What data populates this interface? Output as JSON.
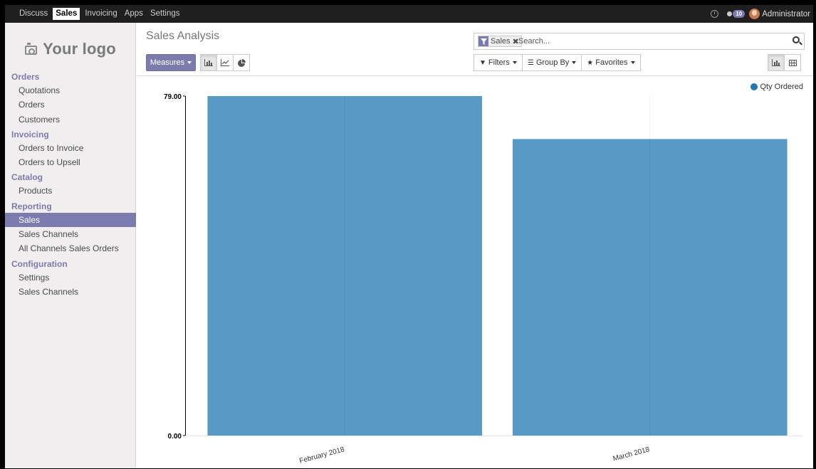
{
  "topbar": {
    "apps": [
      "Discuss",
      "Sales",
      "Invoicing",
      "Apps",
      "Settings"
    ],
    "active_app": "Sales",
    "messages_count": "10",
    "username": "Administrator"
  },
  "sidebar": {
    "logo_text": "Your logo",
    "sections": [
      {
        "title": "Orders",
        "items": [
          "Quotations",
          "Orders",
          "Customers"
        ]
      },
      {
        "title": "Invoicing",
        "items": [
          "Orders to Invoice",
          "Orders to Upsell"
        ]
      },
      {
        "title": "Catalog",
        "items": [
          "Products"
        ]
      },
      {
        "title": "Reporting",
        "items": [
          "Sales",
          "Sales Channels",
          "All Channels Sales Orders"
        ]
      },
      {
        "title": "Configuration",
        "items": [
          "Settings",
          "Sales Channels"
        ]
      }
    ],
    "active_item": "Reporting/Sales"
  },
  "control_panel": {
    "title": "Sales Analysis",
    "measures_label": "Measures",
    "search": {
      "facet_label": "Sales",
      "placeholder": "Search..."
    },
    "filters_label": "Filters",
    "groupby_label": "Group By",
    "favorites_label": "Favorites"
  },
  "colors": {
    "accent": "#7c7bad",
    "bar": "#5899c6",
    "legend_dot": "#1f77b4"
  },
  "chart_data": {
    "type": "bar",
    "categories": [
      "February 2018",
      "March 2018"
    ],
    "series": [
      {
        "name": "Qty Ordered",
        "values": [
          79,
          69
        ]
      }
    ],
    "ylim": [
      0,
      79
    ],
    "y_ticks": [
      "0.00",
      "79.00"
    ],
    "legend_position": "top-right",
    "grid": false
  }
}
